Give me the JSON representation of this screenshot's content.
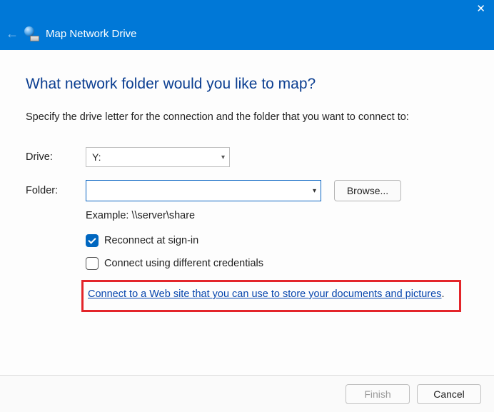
{
  "window": {
    "title": "Map Network Drive"
  },
  "main": {
    "heading": "What network folder would you like to map?",
    "instruction": "Specify the drive letter for the connection and the folder that you want to connect to:"
  },
  "form": {
    "drive_label": "Drive:",
    "drive_value": "Y:",
    "folder_label": "Folder:",
    "folder_value": "",
    "browse_label": "Browse...",
    "example_text": "Example: \\\\server\\share",
    "reconnect_label": "Reconnect at sign-in",
    "reconnect_checked": true,
    "diffcred_label": "Connect using different credentials",
    "diffcred_checked": false,
    "website_link": "Connect to a Web site that you can use to store your documents and pictures"
  },
  "footer": {
    "finish_label": "Finish",
    "cancel_label": "Cancel"
  }
}
